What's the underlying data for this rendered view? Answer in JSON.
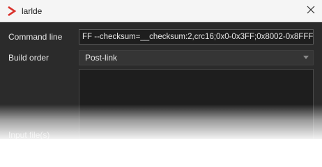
{
  "window": {
    "title": "larlde",
    "close_icon": "close-icon",
    "app_icon": "chevron-logo-icon",
    "accent_color": "#d9302a"
  },
  "form": {
    "command_line": {
      "label": "Command line",
      "value": "FF --checksum=__checksum:2,crc16;0x0-0x3FF;0x8002-0x8FFF"
    },
    "build_order": {
      "label": "Build order",
      "selected": "Post-link"
    },
    "input_files": {
      "label": "Input file(s)"
    }
  }
}
